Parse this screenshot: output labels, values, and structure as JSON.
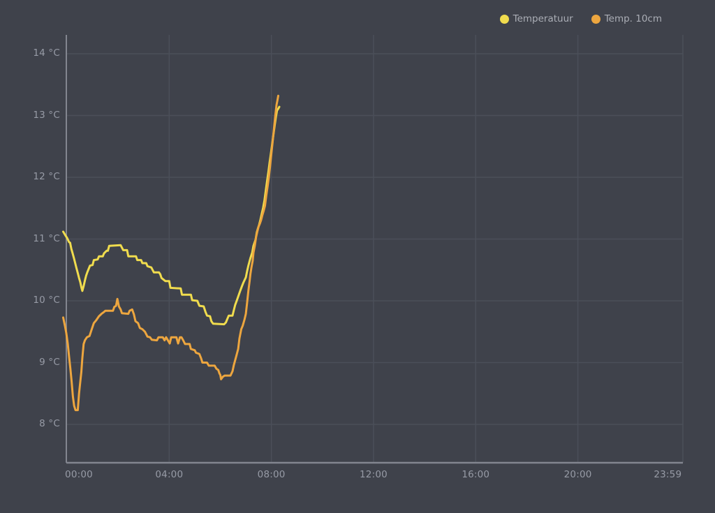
{
  "colors": {
    "background": "#3f424b",
    "gridline": "#4b4f59",
    "axis_line": "#82858f",
    "tick_text": "#979ba6",
    "legend_text": "#abaeb6",
    "series_yellow": "#f0dc4e",
    "series_orange": "#eda63f"
  },
  "chart_data": {
    "type": "line",
    "title": "",
    "xlabel": "",
    "ylabel": "",
    "legend_position": "top-right",
    "grid": true,
    "x_axis": {
      "unit": "time",
      "range_hours": [
        -0.15,
        24.11
      ],
      "ticks": [
        {
          "t": 0,
          "label": "00:00"
        },
        {
          "t": 4,
          "label": "04:00"
        },
        {
          "t": 8,
          "label": "08:00"
        },
        {
          "t": 12,
          "label": "12:00"
        },
        {
          "t": 16,
          "label": "16:00"
        },
        {
          "t": 20,
          "label": "20:00"
        },
        {
          "t": 23.983,
          "label": "23:59"
        }
      ]
    },
    "y_axis": {
      "unit": "°C",
      "range": [
        7.4,
        14.3
      ],
      "ticks": [
        {
          "v": 14,
          "label": "14 °C"
        },
        {
          "v": 13,
          "label": "13 °C"
        },
        {
          "v": 12,
          "label": "12 °C"
        },
        {
          "v": 11,
          "label": "11 °C"
        },
        {
          "v": 10,
          "label": "10 °C"
        },
        {
          "v": 9,
          "label": "9 °C"
        },
        {
          "v": 8,
          "label": "8 °C"
        }
      ]
    },
    "series": [
      {
        "name": "Temperatuur",
        "color": "#f0dc4e",
        "points": [
          [
            -0.15,
            11.12
          ],
          [
            -0.05,
            11.05
          ],
          [
            0.0,
            11.02
          ],
          [
            0.08,
            10.95
          ],
          [
            0.12,
            10.94
          ],
          [
            0.17,
            10.84
          ],
          [
            0.22,
            10.77
          ],
          [
            0.27,
            10.69
          ],
          [
            0.32,
            10.61
          ],
          [
            0.37,
            10.53
          ],
          [
            0.42,
            10.45
          ],
          [
            0.47,
            10.37
          ],
          [
            0.52,
            10.3
          ],
          [
            0.56,
            10.22
          ],
          [
            0.6,
            10.16
          ],
          [
            0.65,
            10.24
          ],
          [
            0.7,
            10.33
          ],
          [
            0.75,
            10.41
          ],
          [
            0.8,
            10.47
          ],
          [
            0.85,
            10.52
          ],
          [
            0.9,
            10.57
          ],
          [
            1.0,
            10.58
          ],
          [
            1.05,
            10.66
          ],
          [
            1.2,
            10.67
          ],
          [
            1.25,
            10.72
          ],
          [
            1.4,
            10.72
          ],
          [
            1.45,
            10.77
          ],
          [
            1.55,
            10.81
          ],
          [
            1.6,
            10.81
          ],
          [
            1.65,
            10.89
          ],
          [
            2.1,
            10.9
          ],
          [
            2.2,
            10.82
          ],
          [
            2.35,
            10.82
          ],
          [
            2.4,
            10.72
          ],
          [
            2.7,
            10.72
          ],
          [
            2.75,
            10.66
          ],
          [
            2.9,
            10.66
          ],
          [
            2.95,
            10.61
          ],
          [
            3.1,
            10.61
          ],
          [
            3.15,
            10.56
          ],
          [
            3.3,
            10.54
          ],
          [
            3.4,
            10.46
          ],
          [
            3.6,
            10.46
          ],
          [
            3.65,
            10.43
          ],
          [
            3.7,
            10.37
          ],
          [
            3.85,
            10.32
          ],
          [
            4.0,
            10.32
          ],
          [
            4.05,
            10.21
          ],
          [
            4.45,
            10.2
          ],
          [
            4.5,
            10.1
          ],
          [
            4.85,
            10.1
          ],
          [
            4.9,
            10.01
          ],
          [
            5.1,
            10.0
          ],
          [
            5.18,
            9.92
          ],
          [
            5.35,
            9.91
          ],
          [
            5.42,
            9.82
          ],
          [
            5.48,
            9.76
          ],
          [
            5.6,
            9.75
          ],
          [
            5.65,
            9.67
          ],
          [
            5.72,
            9.63
          ],
          [
            6.15,
            9.62
          ],
          [
            6.22,
            9.65
          ],
          [
            6.28,
            9.71
          ],
          [
            6.33,
            9.76
          ],
          [
            6.48,
            9.76
          ],
          [
            6.53,
            9.85
          ],
          [
            6.58,
            9.93
          ],
          [
            6.65,
            10.01
          ],
          [
            6.72,
            10.09
          ],
          [
            6.78,
            10.16
          ],
          [
            6.85,
            10.24
          ],
          [
            6.9,
            10.29
          ],
          [
            7.0,
            10.38
          ],
          [
            7.05,
            10.48
          ],
          [
            7.1,
            10.57
          ],
          [
            7.18,
            10.69
          ],
          [
            7.25,
            10.78
          ],
          [
            7.3,
            10.89
          ],
          [
            7.38,
            10.99
          ],
          [
            7.43,
            11.11
          ],
          [
            7.48,
            11.18
          ],
          [
            7.52,
            11.23
          ],
          [
            7.57,
            11.31
          ],
          [
            7.62,
            11.4
          ],
          [
            7.68,
            11.51
          ],
          [
            7.73,
            11.63
          ],
          [
            7.78,
            11.78
          ],
          [
            7.83,
            11.93
          ],
          [
            7.88,
            12.08
          ],
          [
            7.93,
            12.24
          ],
          [
            7.98,
            12.38
          ],
          [
            8.03,
            12.53
          ],
          [
            8.08,
            12.69
          ],
          [
            8.13,
            12.84
          ],
          [
            8.18,
            12.98
          ],
          [
            8.22,
            13.08
          ],
          [
            8.27,
            13.11
          ],
          [
            8.31,
            13.14
          ]
        ]
      },
      {
        "name": "Temp. 10cm",
        "color": "#eda63f",
        "points": [
          [
            -0.15,
            9.73
          ],
          [
            -0.08,
            9.59
          ],
          [
            -0.03,
            9.48
          ],
          [
            0.03,
            9.3
          ],
          [
            0.08,
            9.1
          ],
          [
            0.13,
            8.9
          ],
          [
            0.18,
            8.69
          ],
          [
            0.23,
            8.45
          ],
          [
            0.28,
            8.3
          ],
          [
            0.33,
            8.23
          ],
          [
            0.42,
            8.23
          ],
          [
            0.47,
            8.5
          ],
          [
            0.52,
            8.69
          ],
          [
            0.56,
            8.85
          ],
          [
            0.6,
            9.07
          ],
          [
            0.65,
            9.3
          ],
          [
            0.7,
            9.36
          ],
          [
            0.78,
            9.41
          ],
          [
            0.88,
            9.43
          ],
          [
            0.95,
            9.52
          ],
          [
            1.05,
            9.64
          ],
          [
            1.15,
            9.69
          ],
          [
            1.25,
            9.75
          ],
          [
            1.35,
            9.79
          ],
          [
            1.45,
            9.82
          ],
          [
            1.5,
            9.84
          ],
          [
            1.8,
            9.84
          ],
          [
            1.85,
            9.9
          ],
          [
            1.92,
            9.92
          ],
          [
            1.97,
            10.03
          ],
          [
            2.03,
            9.91
          ],
          [
            2.1,
            9.86
          ],
          [
            2.15,
            9.8
          ],
          [
            2.4,
            9.79
          ],
          [
            2.45,
            9.84
          ],
          [
            2.55,
            9.86
          ],
          [
            2.62,
            9.78
          ],
          [
            2.68,
            9.67
          ],
          [
            2.78,
            9.64
          ],
          [
            2.85,
            9.56
          ],
          [
            2.95,
            9.54
          ],
          [
            3.05,
            9.5
          ],
          [
            3.15,
            9.42
          ],
          [
            3.25,
            9.41
          ],
          [
            3.32,
            9.37
          ],
          [
            3.52,
            9.36
          ],
          [
            3.58,
            9.41
          ],
          [
            3.75,
            9.41
          ],
          [
            3.82,
            9.36
          ],
          [
            3.88,
            9.41
          ],
          [
            3.95,
            9.36
          ],
          [
            4.02,
            9.31
          ],
          [
            4.08,
            9.41
          ],
          [
            4.28,
            9.41
          ],
          [
            4.35,
            9.31
          ],
          [
            4.42,
            9.41
          ],
          [
            4.48,
            9.41
          ],
          [
            4.55,
            9.36
          ],
          [
            4.62,
            9.3
          ],
          [
            4.8,
            9.3
          ],
          [
            4.85,
            9.22
          ],
          [
            5.0,
            9.2
          ],
          [
            5.05,
            9.16
          ],
          [
            5.18,
            9.14
          ],
          [
            5.25,
            9.07
          ],
          [
            5.3,
            9.0
          ],
          [
            5.48,
            9.0
          ],
          [
            5.55,
            8.95
          ],
          [
            5.78,
            8.95
          ],
          [
            5.85,
            8.9
          ],
          [
            5.92,
            8.88
          ],
          [
            5.97,
            8.82
          ],
          [
            6.0,
            8.8
          ],
          [
            6.03,
            8.73
          ],
          [
            6.1,
            8.77
          ],
          [
            6.17,
            8.79
          ],
          [
            6.4,
            8.79
          ],
          [
            6.48,
            8.86
          ],
          [
            6.53,
            8.96
          ],
          [
            6.63,
            9.11
          ],
          [
            6.7,
            9.22
          ],
          [
            6.75,
            9.39
          ],
          [
            6.82,
            9.54
          ],
          [
            6.88,
            9.6
          ],
          [
            6.95,
            9.7
          ],
          [
            7.0,
            9.79
          ],
          [
            7.05,
            9.97
          ],
          [
            7.1,
            10.16
          ],
          [
            7.15,
            10.32
          ],
          [
            7.18,
            10.43
          ],
          [
            7.22,
            10.54
          ],
          [
            7.27,
            10.65
          ],
          [
            7.3,
            10.78
          ],
          [
            7.35,
            10.89
          ],
          [
            7.4,
            11.03
          ],
          [
            7.45,
            11.12
          ],
          [
            7.5,
            11.2
          ],
          [
            7.55,
            11.25
          ],
          [
            7.6,
            11.31
          ],
          [
            7.65,
            11.39
          ],
          [
            7.7,
            11.46
          ],
          [
            7.75,
            11.54
          ],
          [
            7.8,
            11.7
          ],
          [
            7.85,
            11.85
          ],
          [
            7.9,
            12.0
          ],
          [
            7.95,
            12.18
          ],
          [
            8.0,
            12.38
          ],
          [
            8.05,
            12.58
          ],
          [
            8.1,
            12.78
          ],
          [
            8.15,
            12.98
          ],
          [
            8.2,
            13.17
          ],
          [
            8.24,
            13.25
          ],
          [
            8.27,
            13.32
          ]
        ]
      }
    ]
  }
}
